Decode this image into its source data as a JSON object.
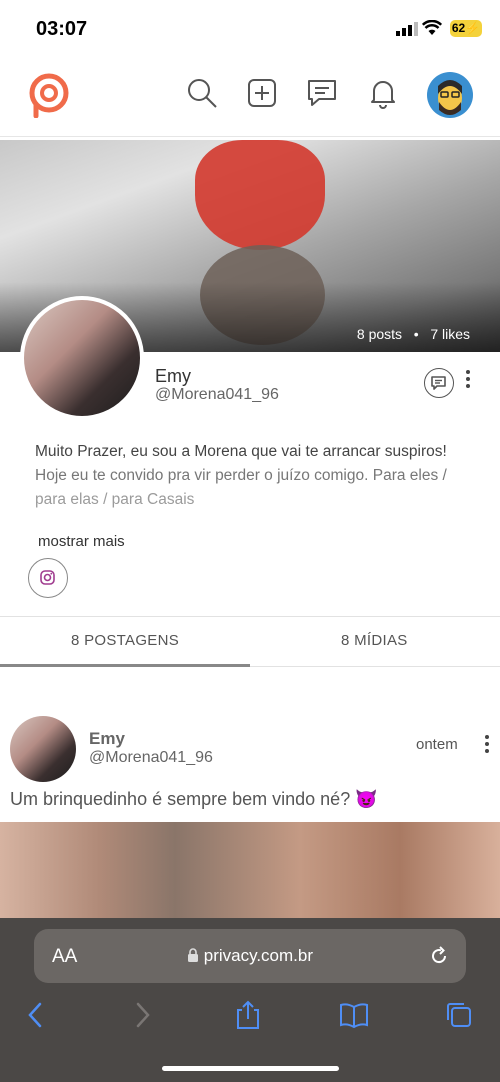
{
  "status_bar": {
    "time": "03:07",
    "battery": "62"
  },
  "profile": {
    "posts_count": "8 posts",
    "likes_count": "7 likes",
    "stats_separator": "•",
    "name": "Emy",
    "handle": "@Morena041_96",
    "bio_line1": "Muito Prazer, eu sou a Morena que vai te arrancar suspiros!",
    "bio_line2": "Hoje eu te convido pra vir perder o juízo comigo. Para eles /",
    "bio_line3": "para elas / para Casais",
    "show_more": "mostrar mais"
  },
  "tabs": [
    {
      "label": "8 POSTAGENS",
      "active": true
    },
    {
      "label": "8 MÍDIAS",
      "active": false
    }
  ],
  "post": {
    "author": "Emy",
    "handle": "@Morena041_96",
    "time": "ontem",
    "text": "Um brinquedinho é sempre bem vindo né? 😈"
  },
  "browser": {
    "aa_label": "AA",
    "url": "privacy.com.br"
  },
  "colors": {
    "brand": "#f06b4a",
    "safari_bar": "#4b4846",
    "accent_blue": "#4f8ef5"
  },
  "icons": [
    "search-icon",
    "add-post-icon",
    "messages-icon",
    "bell-icon",
    "instagram-icon",
    "chat-icon",
    "more-icon",
    "lock-icon",
    "reload-icon",
    "back-icon",
    "forward-icon",
    "share-icon",
    "bookmarks-icon",
    "tabs-icon"
  ]
}
